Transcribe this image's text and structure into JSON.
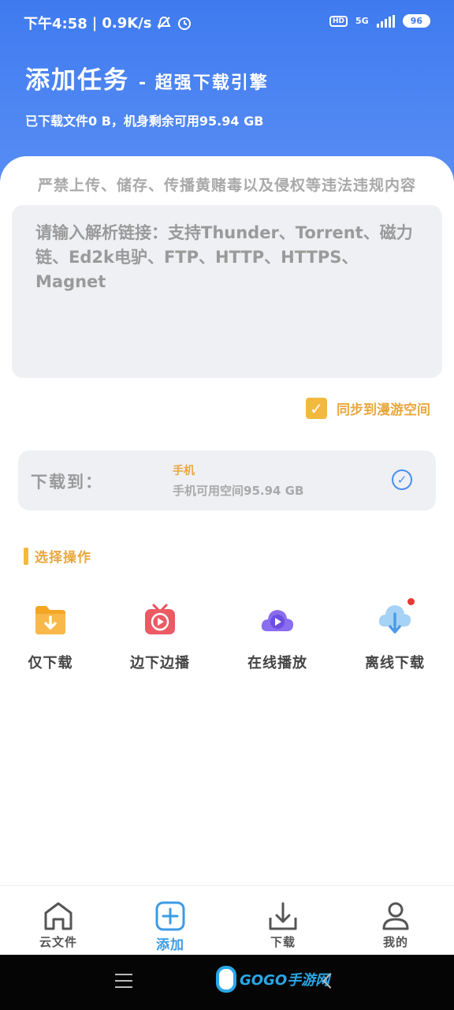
{
  "status_bar": {
    "time": "下午4:58",
    "speed": "0.9K/s",
    "hd": "HD",
    "net": "5G",
    "battery": "96"
  },
  "header": {
    "title": "添加任务",
    "subtitle": "- 超强下载引擎",
    "storage_info": "已下载文件0 B，机身剩余可用95.94 GB"
  },
  "warning": "严禁上传、储存、传播黄赌毒以及侵权等违法违规内容",
  "link_input": {
    "placeholder": "请输入解析链接：支持Thunder、Torrent、磁力链、Ed2k电驴、FTP、HTTP、HTTPS、Magnet"
  },
  "sync": {
    "checked": true,
    "label": "同步到漫游空间"
  },
  "destination": {
    "label": "下载到：",
    "name": "手机",
    "space": "手机可用空间95.94 GB"
  },
  "section_title": "选择操作",
  "actions": [
    {
      "label": "仅下载",
      "icon": "folder-download-icon"
    },
    {
      "label": "边下边播",
      "icon": "tv-play-icon"
    },
    {
      "label": "在线播放",
      "icon": "cloud-play-icon"
    },
    {
      "label": "离线下载",
      "icon": "cloud-download-icon"
    }
  ],
  "bottom_nav": [
    {
      "label": "云文件",
      "icon": "home-icon",
      "active": false
    },
    {
      "label": "添加",
      "icon": "add-icon",
      "active": true
    },
    {
      "label": "下载",
      "icon": "download-icon",
      "active": false
    },
    {
      "label": "我的",
      "icon": "user-icon",
      "active": false
    }
  ],
  "colors": {
    "header_blue": "#4a84f2",
    "accent_orange": "#e9a73d",
    "active_blue": "#3b9be6"
  },
  "watermark": "GOGO手游网"
}
